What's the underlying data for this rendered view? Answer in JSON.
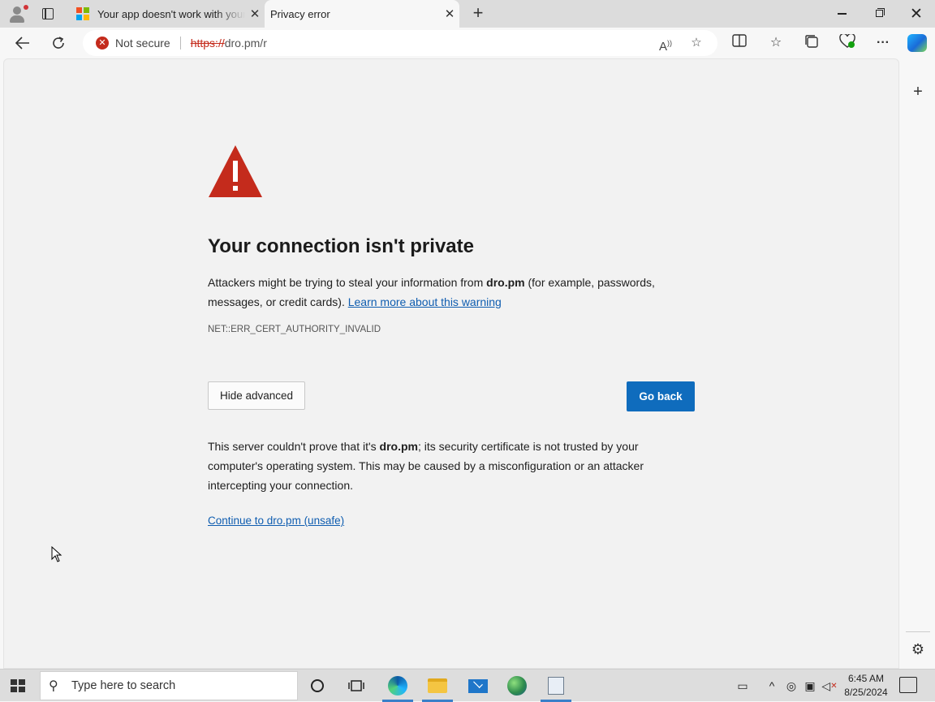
{
  "browser": {
    "tabs": [
      {
        "title": "Your app doesn't work with your",
        "active": false
      },
      {
        "title": "Privacy error",
        "active": true
      }
    ],
    "security_label": "Not secure",
    "url_scheme": "https://",
    "url_rest": "dro.pm/r",
    "icons": [
      "profile-icon",
      "tab-actions-icon",
      "back-icon",
      "refresh-icon",
      "read-aloud-icon",
      "favorite-icon",
      "split-screen-icon",
      "favorites-icon",
      "collections-icon",
      "browser-essentials-icon",
      "more-icon",
      "copilot-icon"
    ]
  },
  "page": {
    "heading": "Your connection isn't private",
    "intro_pre": "Attackers might be trying to steal your information from ",
    "domain": "dro.pm",
    "intro_post": " (for example, passwords, messages, or credit cards). ",
    "learn_more": "Learn more about this warning",
    "error_code": "NET::ERR_CERT_AUTHORITY_INVALID",
    "hide_advanced": "Hide advanced",
    "go_back": "Go back",
    "advanced_pre": "This server couldn't prove that it's ",
    "advanced_post": "; its security certificate is not trusted by your computer's operating system. This may be caused by a misconfiguration or an attacker intercepting your connection.",
    "continue_link": "Continue to dro.pm (unsafe)"
  },
  "taskbar": {
    "search_placeholder": "Type here to search",
    "time": "6:45 AM",
    "date": "8/25/2024"
  },
  "colors": {
    "danger": "#c42b1c",
    "primary_button": "#0f6cbd",
    "link": "#0f5db0"
  }
}
